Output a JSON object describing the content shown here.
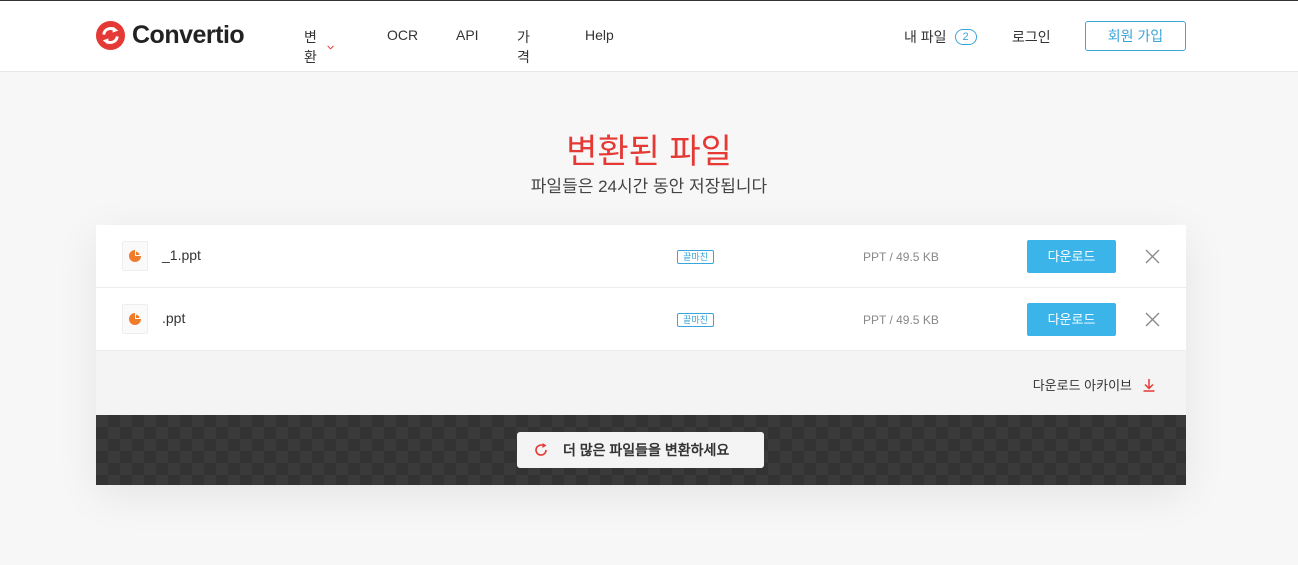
{
  "brand": {
    "name": "Convertio",
    "accent": "#e53935",
    "link": "#3aa5d9"
  },
  "nav": {
    "convert": "변환",
    "ocr": "OCR",
    "api": "API",
    "pricing": "가격",
    "help": "Help"
  },
  "account": {
    "my_files": "내 파일",
    "my_files_count": "2",
    "login": "로그인",
    "signup": "회원 가입"
  },
  "hero": {
    "title": "변환된 파일",
    "subtitle": "파일들은 24시간 동안 저장됩니다"
  },
  "files": [
    {
      "name": "_1.ppt",
      "status": "끝마친",
      "size": "PPT / 49.5 KB",
      "download": "다운로드",
      "icon": "pie-chart-file-icon"
    },
    {
      "name": ".ppt",
      "status": "끝마친",
      "size": "PPT / 49.5 KB",
      "download": "다운로드",
      "icon": "pie-chart-file-icon"
    }
  ],
  "archive": {
    "label": "다운로드 아카이브",
    "icon": "download-arrow-icon"
  },
  "more": {
    "label": "더 많은 파일들을 변환하세요",
    "icon": "refresh-icon"
  }
}
